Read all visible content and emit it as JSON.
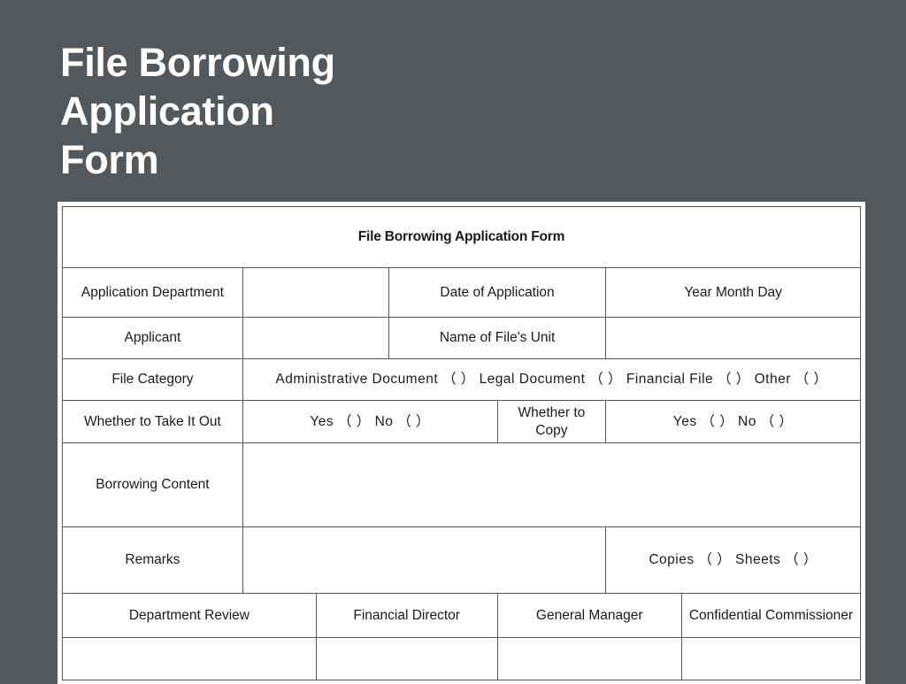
{
  "slide": {
    "title": "File Borrowing\nApplication\nForm",
    "background_color": "#53585c",
    "panel_color": "#ffffff"
  },
  "form": {
    "title": "File Borrowing Application Form",
    "rows": {
      "application_department": {
        "label": "Application Department",
        "value": "",
        "date_label": "Date of Application",
        "date_value": "Year        Month        Day"
      },
      "applicant": {
        "label": "Applicant",
        "value": "",
        "unit_label": "Name of File's Unit",
        "unit_value": ""
      },
      "file_category": {
        "label": "File Category",
        "options": "Administrative Document （    ）  Legal Document （    ）   Financial File （    ）  Other （    ）"
      },
      "take_it_out": {
        "label": "Whether to Take It Out",
        "options": "Yes （   ）  No （   ）",
        "copy_label": "Whether to Copy",
        "copy_options": "Yes （   ）  No （   ）"
      },
      "borrowing_content": {
        "label": "Borrowing Content",
        "value": ""
      },
      "remarks": {
        "label": "Remarks",
        "value": "",
        "counts": "Copies （    ）  Sheets （    ）"
      },
      "signatures": {
        "department_review": "Department Review",
        "financial_director": "Financial Director",
        "general_manager": "General Manager",
        "confidential_commissioner": "Confidential Commissioner",
        "department_review_value": "",
        "financial_director_value": "",
        "general_manager_value": "",
        "confidential_commissioner_value": ""
      }
    }
  }
}
